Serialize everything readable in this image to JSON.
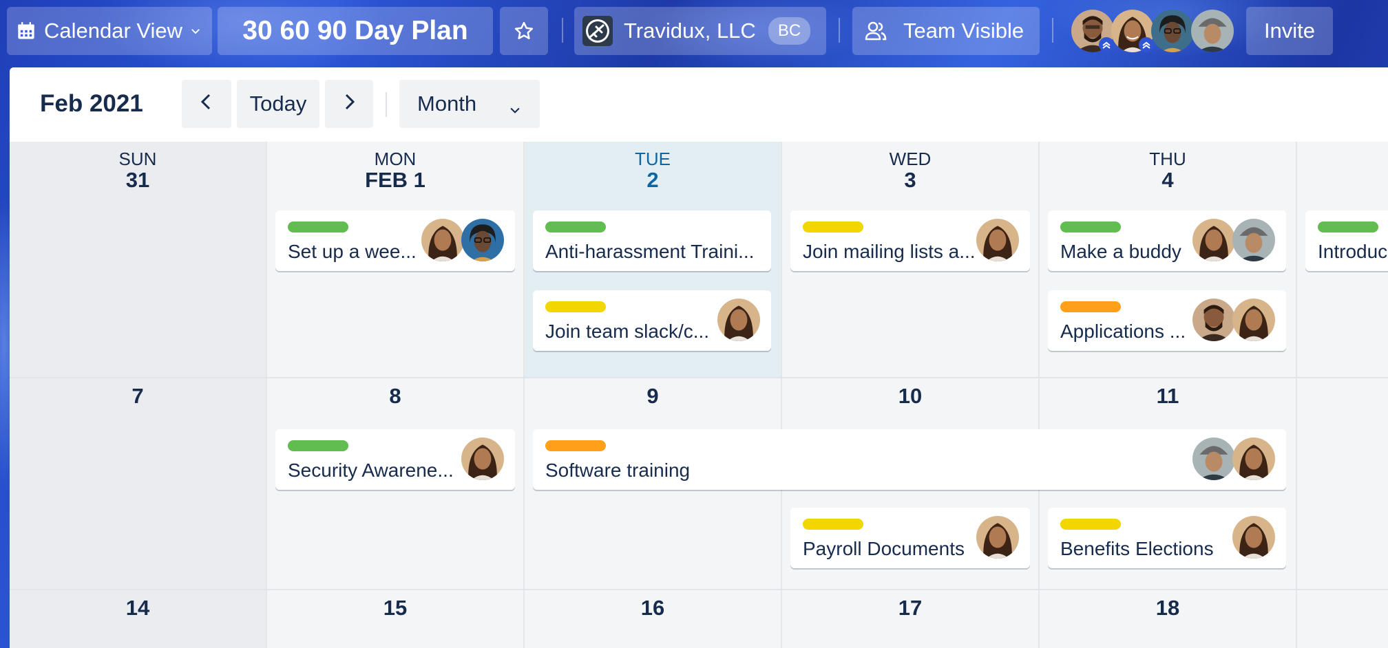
{
  "header": {
    "view_label": "Calendar View",
    "board_title": "30 60 90 Day Plan",
    "workspace_name": "Travidux, LLC",
    "workspace_badge": "BC",
    "visibility_label": "Team Visible",
    "invite_label": "Invite"
  },
  "toolbar": {
    "month_label": "Feb 2021",
    "today_label": "Today",
    "view_select": "Month"
  },
  "week1": {
    "sun": {
      "dow": "SUN",
      "num": "31"
    },
    "mon": {
      "dow": "MON",
      "num": "FEB 1"
    },
    "tue": {
      "dow": "TUE",
      "num": "2"
    },
    "wed": {
      "dow": "WED",
      "num": "3"
    },
    "thu": {
      "dow": "THU",
      "num": "4"
    }
  },
  "week2": [
    "7",
    "8",
    "9",
    "10",
    "11"
  ],
  "week3": [
    "14",
    "15",
    "16",
    "17",
    "18"
  ],
  "cards": {
    "c1": "Set up a wee...",
    "c2": "Anti-harassment Traini...",
    "c3": "Join team slack/c...",
    "c4": "Join mailing lists a...",
    "c5": "Make a buddy",
    "c6": "Applications ...",
    "c7": "Introduc",
    "c8": "Security Awarene...",
    "c9": "Software training",
    "c10": "Payroll Documents",
    "c11": "Benefits Elections"
  },
  "label_colors": {
    "green": "#61bd4f",
    "yellow": "#f2d600",
    "orange": "#ff9f1a"
  },
  "icons": {
    "view": "calendar-icon",
    "star": "star-icon",
    "team": "people-icon",
    "prev": "chevron-left-icon",
    "next": "chevron-right-icon"
  }
}
